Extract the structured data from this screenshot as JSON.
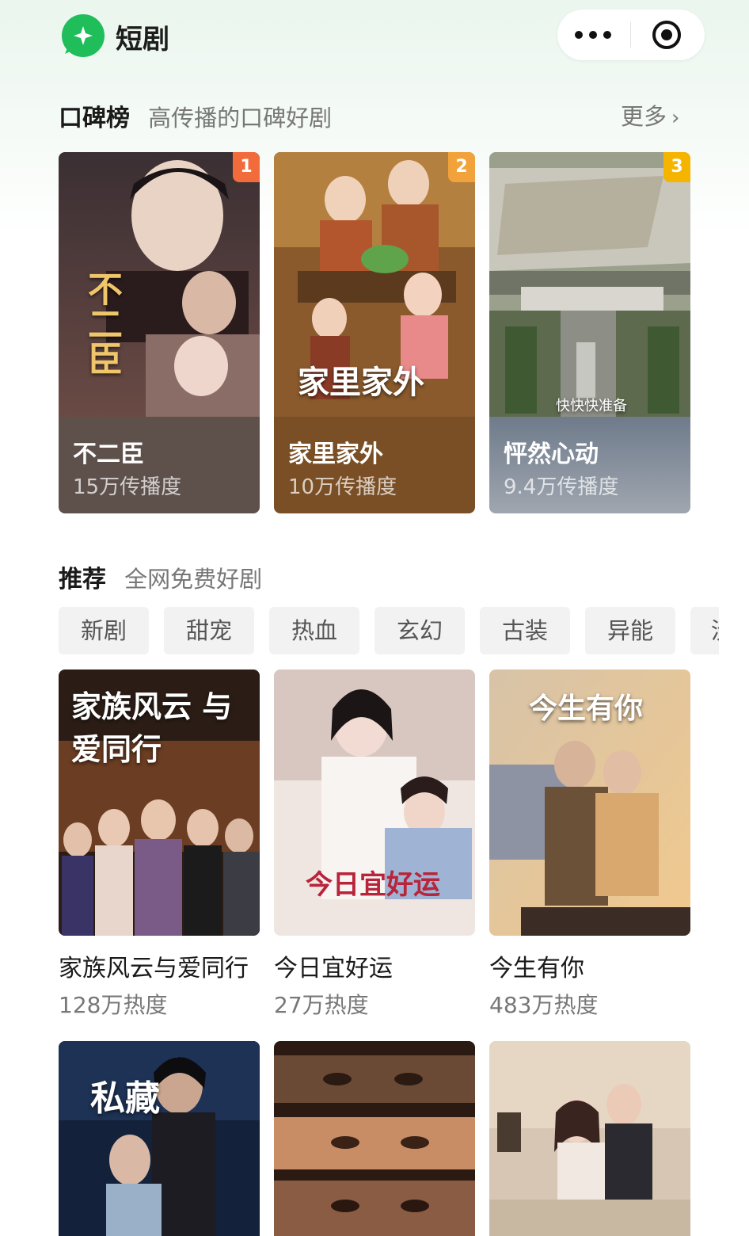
{
  "app": {
    "title": "短剧"
  },
  "rank_section": {
    "title": "口碑榜",
    "subtitle": "高传播的口碑好剧",
    "more_label": "更多"
  },
  "ranked": [
    {
      "rank": "1",
      "name": "不二臣",
      "meta": "15万传播度",
      "poster_text": "不二臣",
      "badge_color": "#f26b3a",
      "info_color": "#5e514b"
    },
    {
      "rank": "2",
      "name": "家里家外",
      "meta": "10万传播度",
      "poster_text": "家里家外",
      "badge_color": "#f2a23a",
      "info_color": "#7a4f26"
    },
    {
      "rank": "3",
      "name": "怦然心动",
      "meta": "9.4万传播度",
      "poster_text": "快快快准备",
      "badge_color": "#f5b400",
      "info_color": "#7d8796"
    }
  ],
  "rec_section": {
    "title": "推荐",
    "subtitle": "全网免费好剧"
  },
  "tags": [
    "新剧",
    "甜宠",
    "热血",
    "玄幻",
    "古装",
    "异能",
    "没"
  ],
  "recommend": [
    {
      "name": "家族风云与爱同行",
      "meta": "128万热度",
      "poster_text": "家族风云 与爱同行"
    },
    {
      "name": "今日宜好运",
      "meta": "27万热度",
      "poster_text": "今日宜好运"
    },
    {
      "name": "今生有你",
      "meta": "483万热度",
      "poster_text": "今生有你"
    },
    {
      "name": "",
      "meta": "",
      "poster_text": "私藏"
    },
    {
      "name": "",
      "meta": "",
      "poster_text": ""
    },
    {
      "name": "",
      "meta": "",
      "poster_text": ""
    }
  ]
}
